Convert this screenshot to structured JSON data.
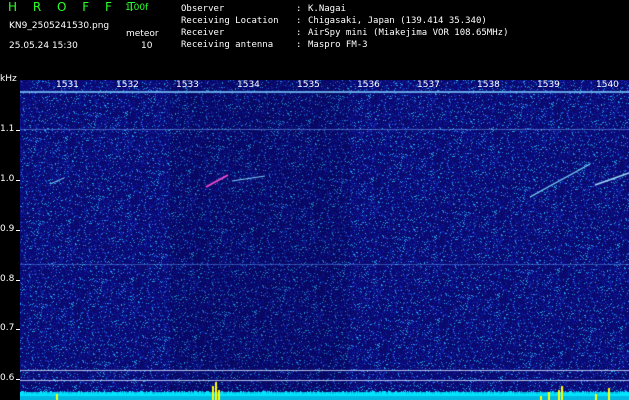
{
  "header": {
    "app_title": "H R O F F T",
    "version": "1.00f",
    "filename": "KN9_2505241530.png",
    "datetime": "25.05.24 15:30",
    "meteor_label": "meteor",
    "meteor_count": "10"
  },
  "info": [
    {
      "key": "Observer",
      "value": "K.Nagai"
    },
    {
      "key": "Receiving Location",
      "value": "Chigasaki, Japan (139.414 35.340)"
    },
    {
      "key": "Receiver",
      "value": "AirSpy mini (Miakejima VOR 108.65MHz)"
    },
    {
      "key": "Receiving antenna",
      "value": "Maspro FM-3"
    }
  ],
  "axis": {
    "unit": "kHz",
    "y_ticks": [
      "1.1",
      "1.0",
      "0.9",
      "0.8",
      "0.7",
      "0.6"
    ],
    "time_ticks": [
      "1531",
      "1532",
      "1533",
      "1534",
      "1535",
      "1536",
      "1537",
      "1538",
      "1539",
      "1540"
    ]
  },
  "colors": {
    "background": "#0a0a6a",
    "signal": "#00e5ff",
    "peak": "#ffff00",
    "title": "#2cff2c"
  }
}
